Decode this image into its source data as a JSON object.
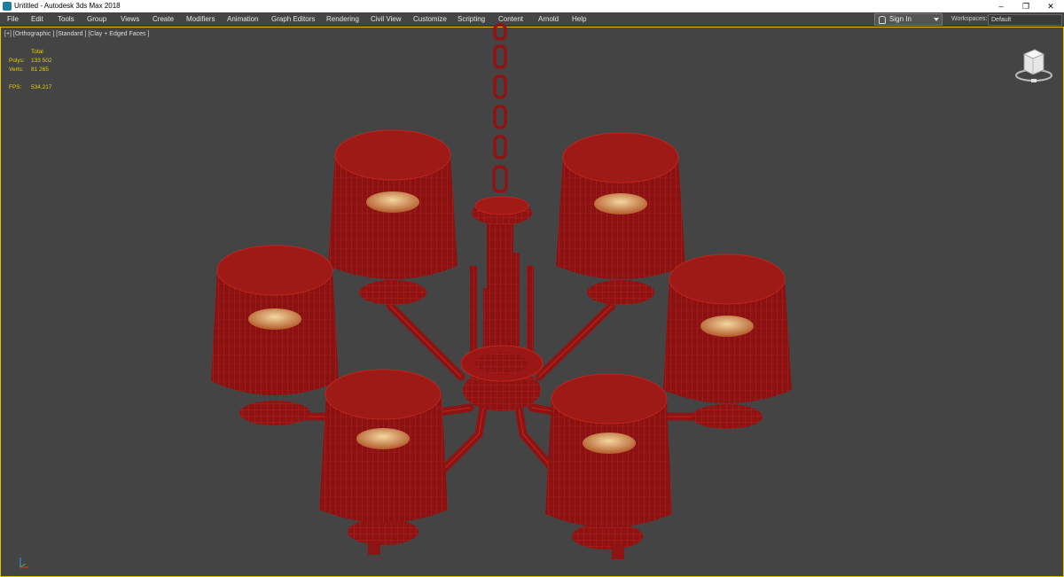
{
  "window": {
    "title": "Untitled - Autodesk 3ds Max 2018",
    "minimize": "–",
    "restore": "❐",
    "close": "✕"
  },
  "menu": [
    "File",
    "Edit",
    "Tools",
    "Group",
    "Views",
    "Create",
    "Modifiers",
    "Animation",
    "Graph Editors",
    "Rendering",
    "Civil View",
    "Customize",
    "Scripting",
    "Content",
    "Arnold",
    "Help"
  ],
  "signin": {
    "label": "Sign In"
  },
  "workspaces": {
    "label": "Workspaces:",
    "value": "Default"
  },
  "viewport": {
    "label": "[+] [Orthographic ] [Standard ] [Clay + Edged Faces ]",
    "stats": {
      "header": "Total",
      "polys_label": "Polys:",
      "polys": "133 502",
      "verts_label": "Verts:",
      "verts": "81 265",
      "fps_label": "FPS:",
      "fps": "534,217"
    }
  },
  "colors": {
    "mesh": "#8e1414",
    "edges": "#c1241c",
    "highlight": "#d23b30",
    "selection": "#e8c300"
  },
  "icons": {
    "viewcube": "viewcube-icon",
    "axis": "axis-tripod-icon",
    "user": "user-icon"
  }
}
